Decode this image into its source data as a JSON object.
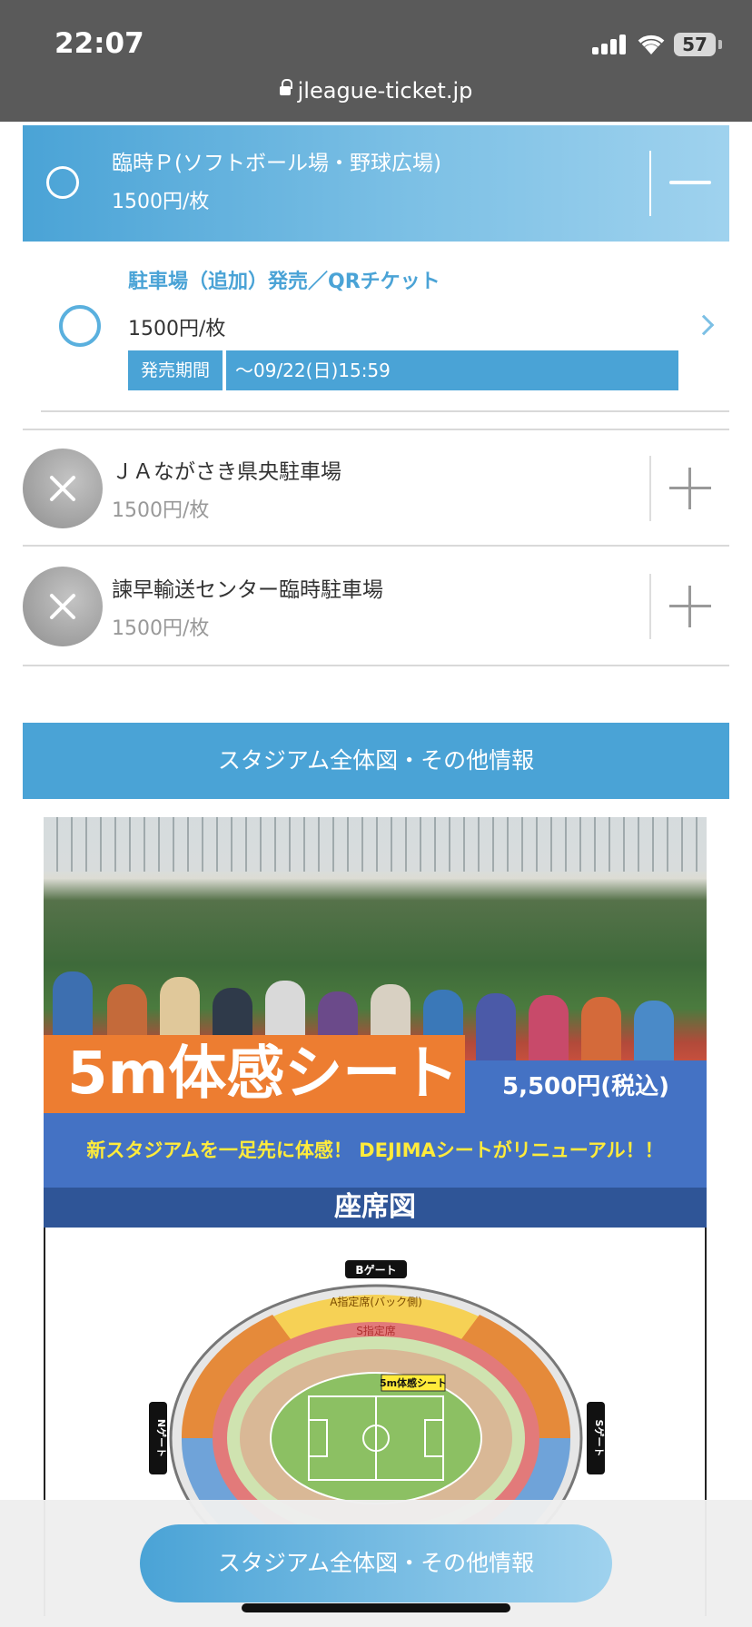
{
  "status_bar": {
    "time": "22:07",
    "battery": "57"
  },
  "browser": {
    "url": "jleague-ticket.jp"
  },
  "selected_option": {
    "title": "臨時Ｐ(ソフトボール場・野球広場)",
    "price": "1500円/枚"
  },
  "sub_option": {
    "title": "駐車場（追加）発売／QRチケット",
    "price": "1500円/枚",
    "period_label": "発売期間",
    "period_value": "〜09/22(日)15:59"
  },
  "unavailable_options": [
    {
      "title": "ＪＡながさき県央駐車場",
      "price": "1500円/枚"
    },
    {
      "title": "諫早輸送センター臨時駐車場",
      "price": "1500円/枚"
    }
  ],
  "section": {
    "title": "スタジアム全体図・その他情報"
  },
  "promo": {
    "headline": "5m体感シート",
    "price": "5,500円(税込)",
    "tagline": "新スタジアムを一足先に体感！ DEJIMAシートがリニューアル！！",
    "map_title": "座席図",
    "map_labels": {
      "b_gate": "Bゲート",
      "n_gate": "Nゲート",
      "s_gate": "Sゲート",
      "a_reserved": "A指定席(バック側)",
      "s_reserved": "S指定席",
      "five_m": "5m体感シート"
    }
  },
  "floating_button": {
    "label": "スタジアム全体図・その他情報"
  },
  "colors": {
    "accent": "#4aa3d6",
    "orange": "#ed7d31",
    "promo_blue": "#4472c4",
    "navy": "#2f5597"
  }
}
